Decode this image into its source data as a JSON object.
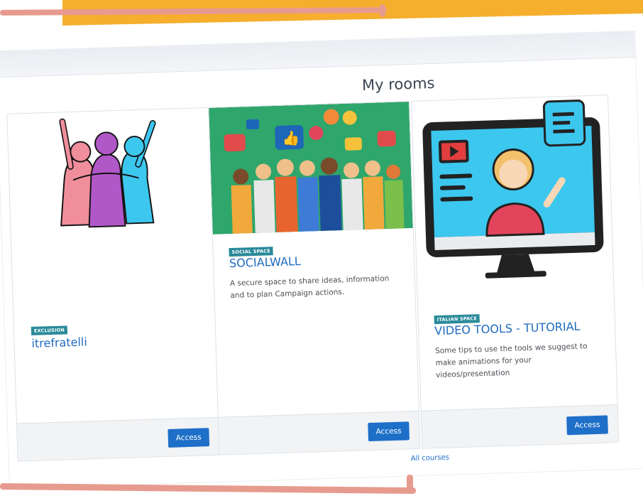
{
  "page": {
    "section_title": "My rooms",
    "all_courses_label": "All courses"
  },
  "rooms": [
    {
      "badge": "EXCLUSION",
      "title": "itrefratelli",
      "description": "",
      "action_label": "Access",
      "image": "group-hug-illustration"
    },
    {
      "badge": "SOCIAL SPACE",
      "title": "SOCIALWALL",
      "description": "A secure space to share ideas, information and to plan Campaign actions.",
      "action_label": "Access",
      "image": "social-media-crowd-illustration"
    },
    {
      "badge": "ITALIAN SPACE",
      "title": "VIDEO TOOLS - TUTORIAL",
      "description": "Some tips to use the tools we suggest to make animations for your videos/presentation",
      "action_label": "Access",
      "image": "video-tutorial-monitor-illustration"
    }
  ],
  "colors": {
    "accent_blue": "#1e6fc8",
    "badge_teal": "#2a8a9a",
    "tape_yellow": "#f6ae2d",
    "stroke_pink": "#e79b8e"
  }
}
